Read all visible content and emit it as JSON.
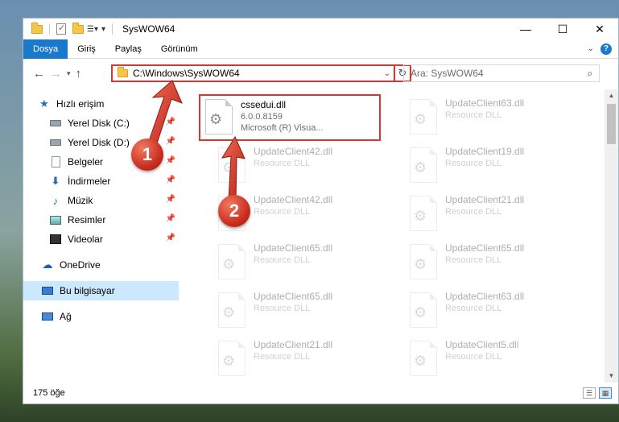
{
  "window": {
    "title": "SysWOW64",
    "controls": {
      "minimize": "—",
      "maximize": "☐",
      "close": "✕"
    }
  },
  "ribbon": {
    "tabs": [
      "Dosya",
      "Giriş",
      "Paylaş",
      "Görünüm"
    ],
    "active_tab": "Dosya",
    "help": "?"
  },
  "address": {
    "path": "C:\\Windows\\SysWOW64",
    "search_placeholder": "Ara: SysWOW64"
  },
  "nav_pane": {
    "quick_access": "Hızlı erişim",
    "items": [
      {
        "label": "Yerel Disk (C:)",
        "pinned": true
      },
      {
        "label": "Yerel Disk (D:)",
        "pinned": true
      },
      {
        "label": "Belgeler",
        "pinned": true
      },
      {
        "label": "İndirmeler",
        "pinned": true
      },
      {
        "label": "Müzik",
        "pinned": true
      },
      {
        "label": "Resimler",
        "pinned": true
      },
      {
        "label": "Videolar",
        "pinned": true
      }
    ],
    "onedrive": "OneDrive",
    "this_pc": "Bu bilgisayar",
    "network": "Ağ"
  },
  "files": {
    "highlighted": {
      "name": "cssedui.dll",
      "version": "6.0.0.8159",
      "company": "Microsoft (R) Visua..."
    },
    "background": [
      {
        "name": "UpdateClient63.dll",
        "type": "Resource DLL"
      },
      {
        "name": "UpdateClient42.dll",
        "type": "Resource DLL"
      },
      {
        "name": "UpdateClient19.dll",
        "type": "Resource DLL"
      },
      {
        "name": "UpdateClient42.dll",
        "type": "Resource DLL"
      },
      {
        "name": "UpdateClient21.dll",
        "type": "Resource DLL"
      },
      {
        "name": "UpdateClient65.dll",
        "type": "Resource DLL"
      },
      {
        "name": "UpdateClient65.dll",
        "type": "Resource DLL"
      },
      {
        "name": "UpdateClient65.dll",
        "type": "Resource DLL"
      },
      {
        "name": "UpdateClient63.dll",
        "type": "Resource DLL"
      },
      {
        "name": "UpdateClient21.dll",
        "type": "Resource DLL"
      },
      {
        "name": "UpdateClient5.dll",
        "type": "Resource DLL"
      }
    ]
  },
  "status": {
    "item_count": "175 öğe"
  },
  "callouts": [
    "1",
    "2"
  ],
  "colors": {
    "accent": "#1979ca",
    "highlight_red": "#e0332e",
    "selected_nav": "#cce8ff"
  }
}
